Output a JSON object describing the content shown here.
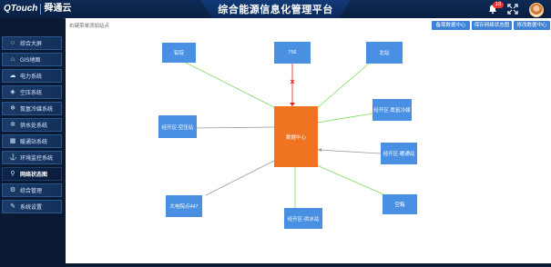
{
  "header": {
    "logo": "QTouch",
    "brand": "舜通云",
    "title": "综合能源信息化管理平台",
    "notification_count": "18",
    "icons": {
      "bell": "bell-icon",
      "fullscreen": "expand-icon",
      "avatar": "avatar"
    }
  },
  "sidebar": {
    "items": [
      {
        "label": "综合大屏",
        "icon": "circle-icon",
        "glyph": "○"
      },
      {
        "label": "GIS地图",
        "icon": "home-icon",
        "glyph": "⌂"
      },
      {
        "label": "电力系统",
        "icon": "cloud-icon",
        "glyph": "☁"
      },
      {
        "label": "空压系统",
        "icon": "layers-icon",
        "glyph": "◈"
      },
      {
        "label": "氮氩冷媒系统",
        "icon": "snowflake-icon",
        "glyph": "❄"
      },
      {
        "label": "供水处系统",
        "icon": "gear-icon",
        "glyph": "✲"
      },
      {
        "label": "暖通站系统",
        "icon": "grid-icon",
        "glyph": "▦"
      },
      {
        "label": "环境监控系统",
        "icon": "anchor-icon",
        "glyph": "⚓"
      },
      {
        "label": "网络状态图",
        "icon": "location-icon",
        "glyph": "⚲"
      },
      {
        "label": "综合管理",
        "icon": "settings-icon",
        "glyph": "⚙"
      },
      {
        "label": "系统设置",
        "icon": "wrench-icon",
        "glyph": "✎"
      }
    ],
    "active_index": 8
  },
  "main": {
    "breadcrumb": "右键菜单添加站点",
    "buttons": [
      "备周数据中心",
      "保存网络状态图",
      "修改数据中心"
    ],
    "center": "数据中心",
    "nodes": [
      "铅锭",
      "756",
      "北站",
      "经开区-氮氩冷媒",
      "经开区-暖通站",
      "空箱",
      "经开区-供水站",
      "大电院点447",
      "经开区-空压站"
    ],
    "broken_link_mark": "×"
  },
  "colors": {
    "node": "#4a90e2",
    "center": "#ee7422",
    "link_ok": "#7ed957",
    "link_gray": "#9a9a9a",
    "link_broken": "#e02020",
    "button": "#3c83d6"
  }
}
